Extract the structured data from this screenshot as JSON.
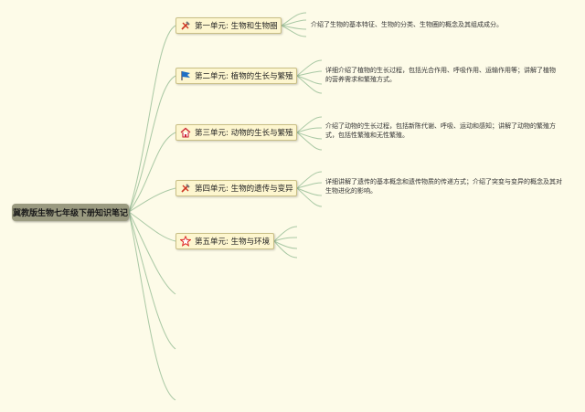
{
  "root": {
    "label": "冀教版生物七年级下册知识笔记"
  },
  "units": [
    {
      "label": "第一单元: 生物和生物圈",
      "icon": "tools-icon",
      "description": "介绍了生物的基本特征、生物的分类、生物圈的概念及其组成成分。"
    },
    {
      "label": "第二单元: 植物的生长与繁殖",
      "icon": "flag-icon",
      "description": "详细介绍了植物的生长过程，包括光合作用、呼吸作用、运输作用等；讲解了植物的营养需求和繁殖方式。"
    },
    {
      "label": "第三单元: 动物的生长与繁殖",
      "icon": "home-icon",
      "description": "介绍了动物的生长过程，包括新陈代谢、呼吸、运动和感知；讲解了动物的繁殖方式，包括性繁殖和无性繁殖。"
    },
    {
      "label": "第四单元: 生物的遗传与变异",
      "icon": "tools-icon",
      "description": "详细讲解了遗传的基本概念和遗传物质的传递方式；介绍了突变与变异的概念及其对生物进化的影响。"
    },
    {
      "label": "第五单元: 生物与环境",
      "icon": "star-icon",
      "description": ""
    }
  ],
  "colors": {
    "branch": "#a9c8a4",
    "background": "#fdfbe8",
    "node_fill": "#fdf6cf",
    "root_fill": "#9a9a80"
  }
}
